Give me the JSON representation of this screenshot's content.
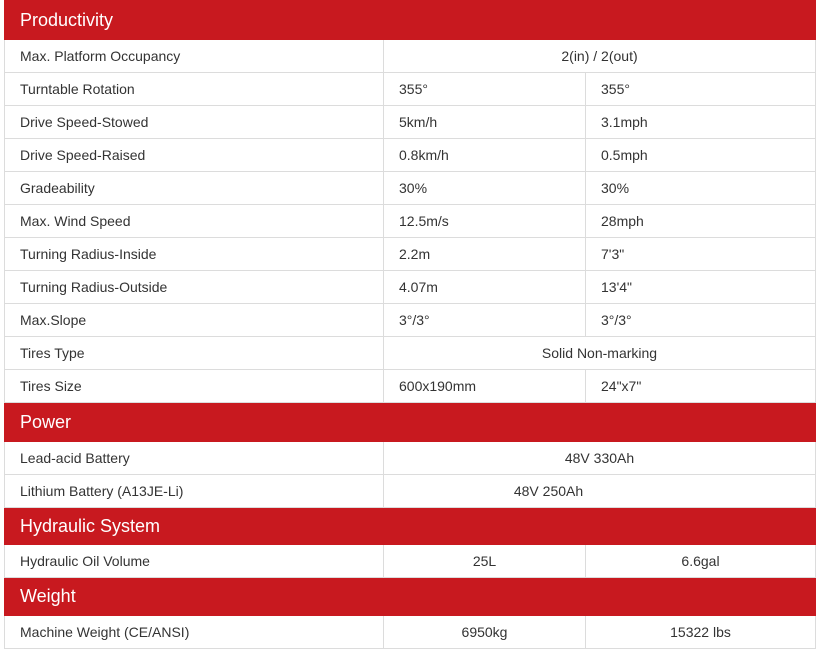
{
  "sections": [
    {
      "title": "Productivity",
      "rows": [
        {
          "label": "Max. Platform Occupancy",
          "merged": "2(in) / 2(out)"
        },
        {
          "label": "Turntable Rotation",
          "metric": "355°",
          "imperial": "355°"
        },
        {
          "label": "Drive Speed-Stowed",
          "metric": "5km/h",
          "imperial": "3.1mph"
        },
        {
          "label": "Drive Speed-Raised",
          "metric": "0.8km/h",
          "imperial": "0.5mph"
        },
        {
          "label": "Gradeability",
          "metric": "30%",
          "imperial": "30%"
        },
        {
          "label": "Max. Wind Speed",
          "metric": "12.5m/s",
          "imperial": "28mph"
        },
        {
          "label": "Turning Radius-Inside",
          "metric": "2.2m",
          "imperial": "7'3\""
        },
        {
          "label": "Turning Radius-Outside",
          "metric": "4.07m",
          "imperial": "13'4\""
        },
        {
          "label": "Max.Slope",
          "metric": "3°/3°",
          "imperial": "3°/3°"
        },
        {
          "label": "Tires Type",
          "merged": "Solid Non-marking"
        },
        {
          "label": "Tires Size",
          "metric": "600x190mm",
          "imperial": "24\"x7\""
        }
      ]
    },
    {
      "title": "Power",
      "rows": [
        {
          "label": "Lead-acid Battery",
          "merged": "48V 330Ah"
        },
        {
          "label": "Lithium Battery (A13JE-Li)",
          "merged": "48V 250Ah"
        }
      ]
    },
    {
      "title": "Hydraulic System",
      "rows": [
        {
          "label": "Hydraulic Oil Volume",
          "metric": "25L",
          "imperial": "6.6gal"
        }
      ]
    },
    {
      "title": "Weight",
      "rows": [
        {
          "label": "Machine Weight (CE/ANSI)",
          "metric": "6950kg",
          "imperial": "15322 lbs"
        }
      ]
    }
  ],
  "colors": {
    "header_bg": "#c8191f",
    "header_text": "#ffffff",
    "cell_border": "#dcdcdc",
    "cell_text": "#333333"
  }
}
